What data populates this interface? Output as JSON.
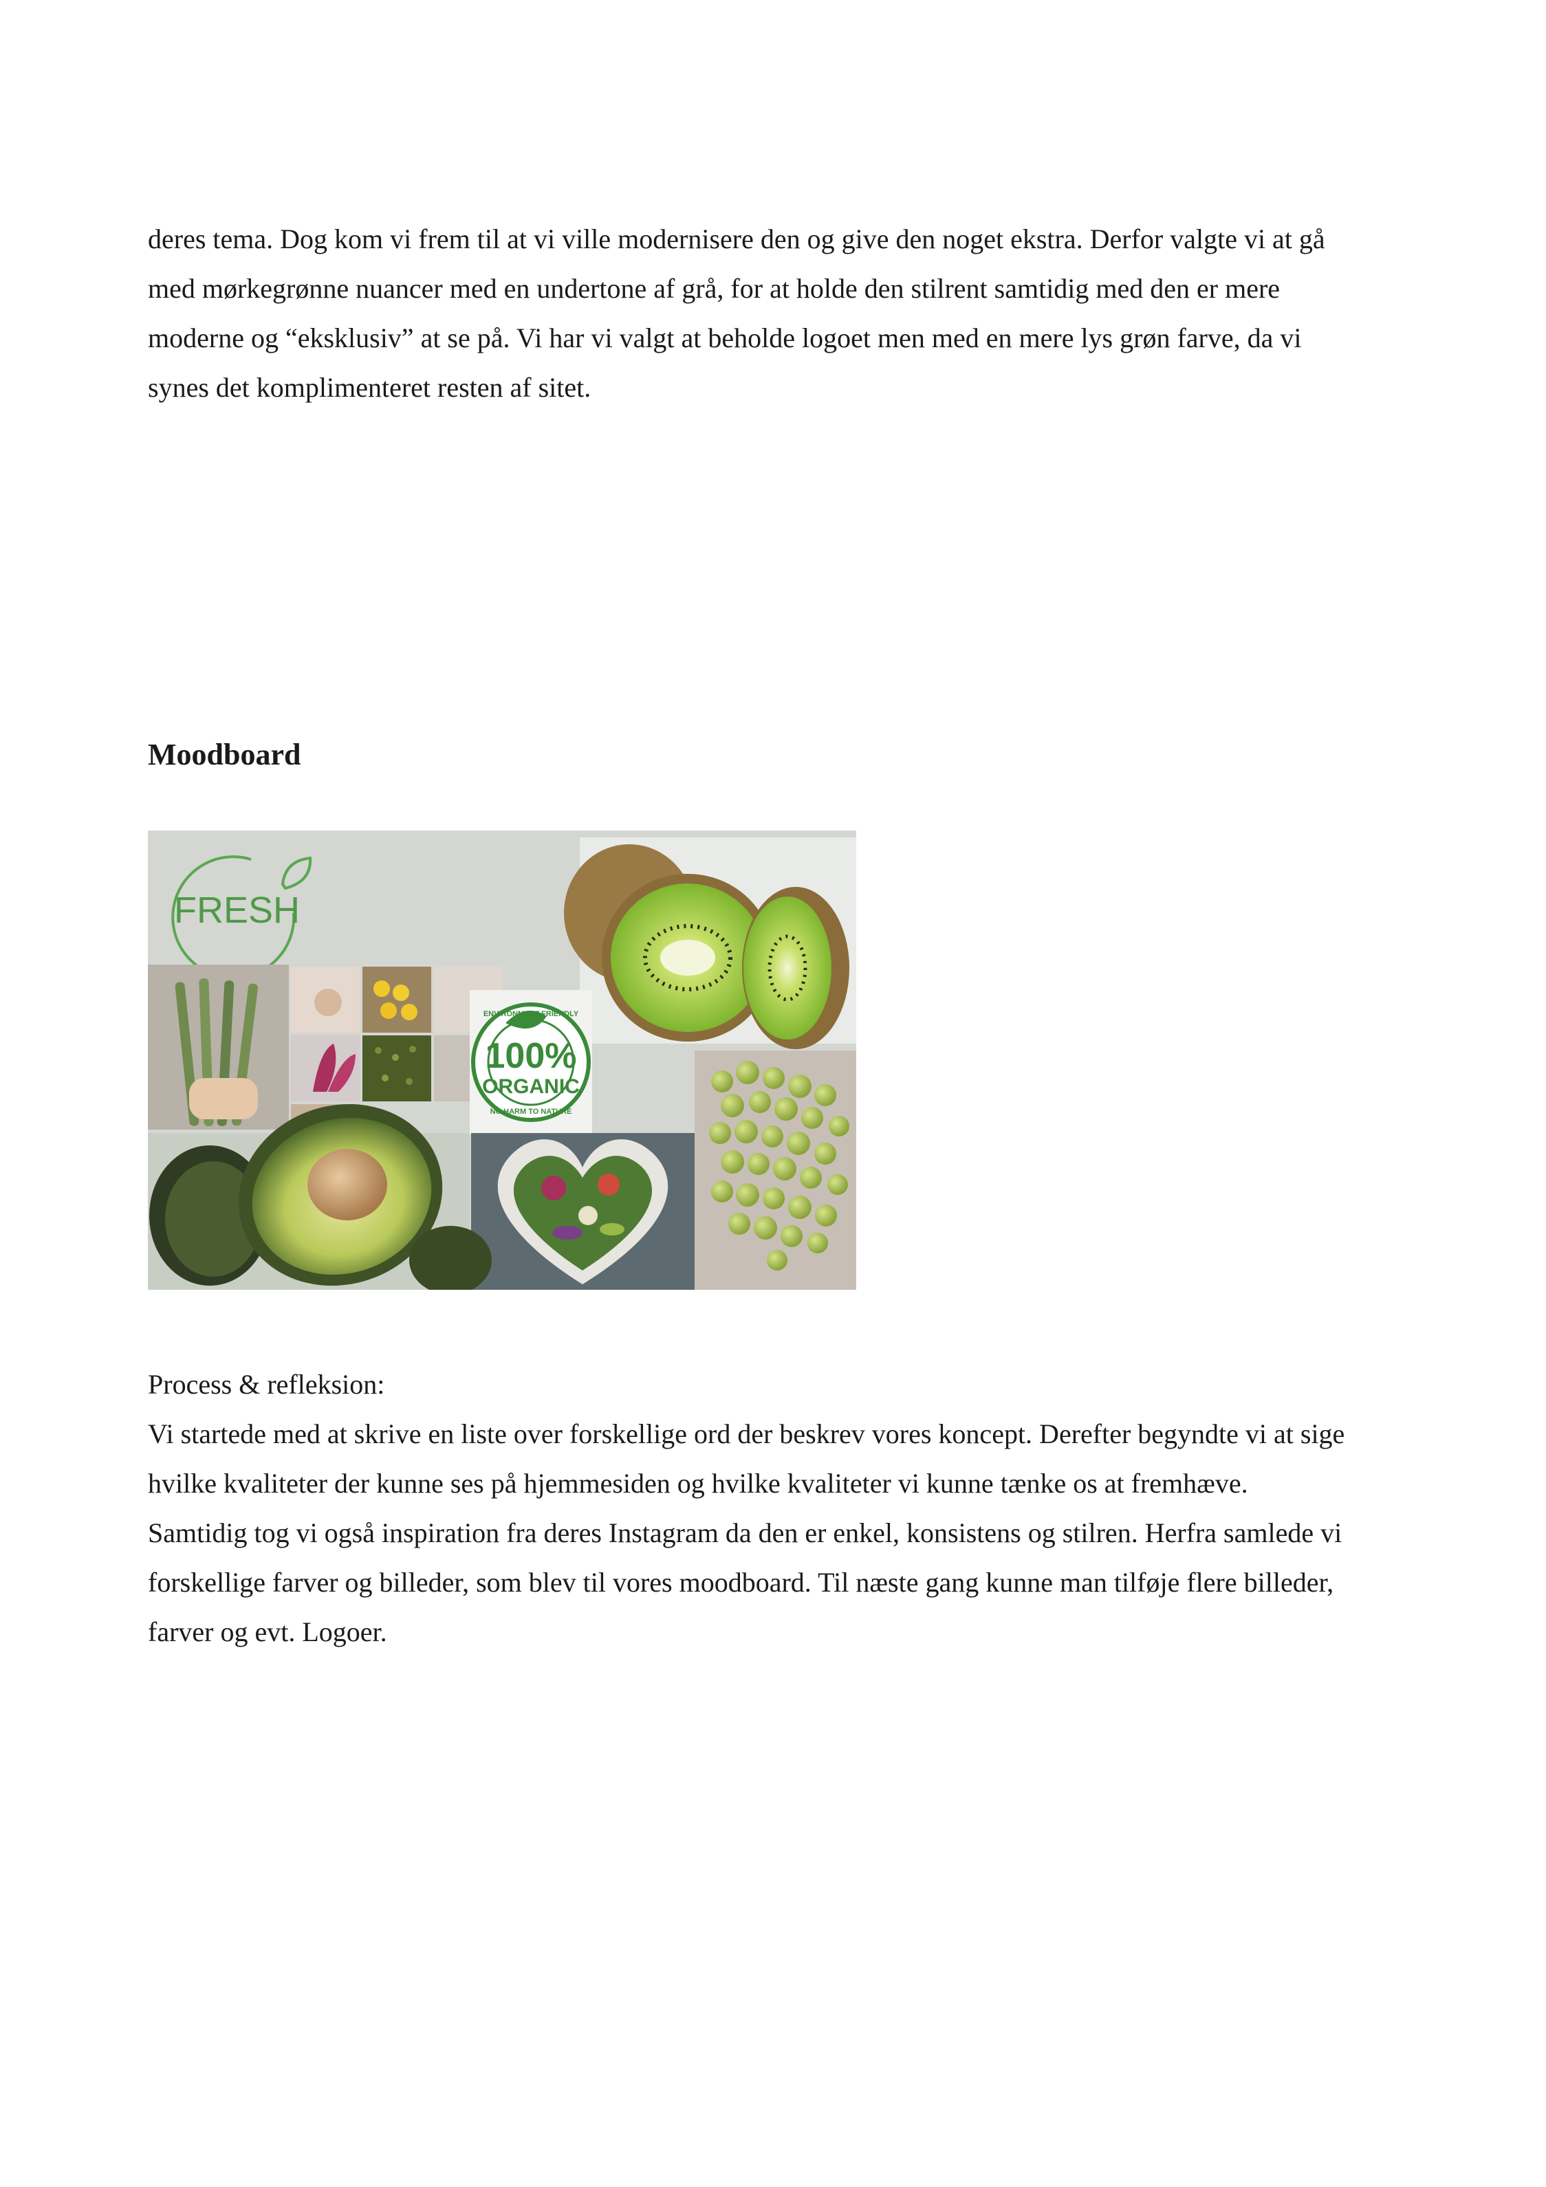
{
  "intro": {
    "lines": [
      "deres tema. Dog kom vi frem til at vi ville modernisere den og give den noget ekstra. Derfor valgte vi at gå",
      "med mørkegrønne nuancer med en undertone af grå, for at holde den stilrent samtidig med den er mere",
      "moderne og “eksklusiv” at se på. Vi har vi valgt at beholde logoet men med en mere lys grøn farve, da vi",
      "synes det komplimenteret resten af sitet."
    ]
  },
  "moodboard": {
    "heading": "Moodboard",
    "logo_text": "FRESH",
    "seal": {
      "percent": "100%",
      "word": "ORGANIC",
      "top_arc": "ENVIRONMENT FRIENDLY",
      "bottom_arc": "NO HARM TO NATURE"
    },
    "colors": {
      "background": "#d4d6d2",
      "kiwi_flesh": "#8cc43c",
      "kiwi_skin": "#8a6b3a",
      "avocado_dark": "#2f3b22",
      "avocado_flesh": "#b9c95a",
      "sprouts": "#a9bd4a",
      "asparagus": "#6f8a4c",
      "slate": "#5d6a70"
    }
  },
  "process": {
    "label": "Process & refleksion:",
    "lines": [
      "Vi startede med at skrive en liste over forskellige ord der beskrev vores koncept. Derefter begyndte vi at sige",
      "hvilke kvaliteter der kunne ses på hjemmesiden og hvilke kvaliteter vi kunne tænke os at fremhæve.",
      "Samtidig tog vi også inspiration fra deres Instagram da den er enkel, konsistens og stilren. Herfra samlede vi",
      "forskellige farver og billeder, som blev til vores moodboard. Til næste gang kunne man tilføje flere billeder,",
      "farver og evt. Logoer."
    ]
  }
}
